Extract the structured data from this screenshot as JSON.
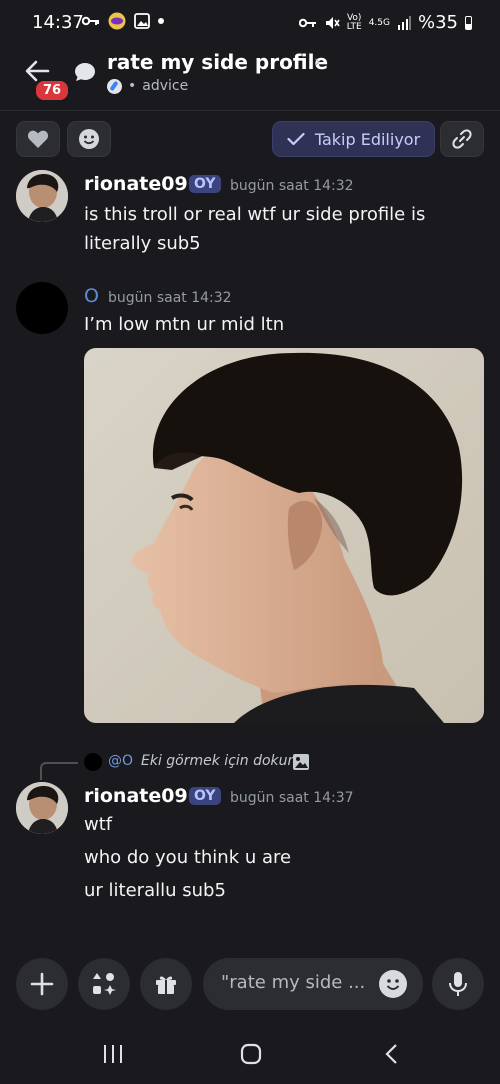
{
  "status_bar": {
    "time": "14:37",
    "network": "4.5G",
    "lte": "LTE",
    "volte": "Vo)",
    "battery": "%35"
  },
  "header": {
    "back_badge": "76",
    "title": "rate my side profile",
    "subtitle": "advice"
  },
  "actions": {
    "follow_label": "Takip Ediliyor"
  },
  "messages": [
    {
      "author": "rionate096",
      "tag": "OY",
      "time": "bugün saat 14:32",
      "lines": [
        "is this troll or real wtf ur side profile is",
        "literally sub5"
      ]
    },
    {
      "author": "O",
      "time": "bugün saat 14:32",
      "lines": [
        "I’m low mtn ur mid ltn"
      ]
    },
    {
      "reply_name": "@O",
      "reply_text": "Eki görmek için dokun",
      "author": "rionate096",
      "tag": "OY",
      "time": "bugün saat 14:37",
      "lines": [
        "wtf",
        "who do you think u are",
        "ur literallu sub5"
      ]
    }
  ],
  "composer": {
    "placeholder": "\"rate my side ..."
  },
  "colors": {
    "background": "#1a1a1e",
    "surface": "#2b2d31",
    "accent": "#5865f2",
    "badge": "#da373c"
  }
}
